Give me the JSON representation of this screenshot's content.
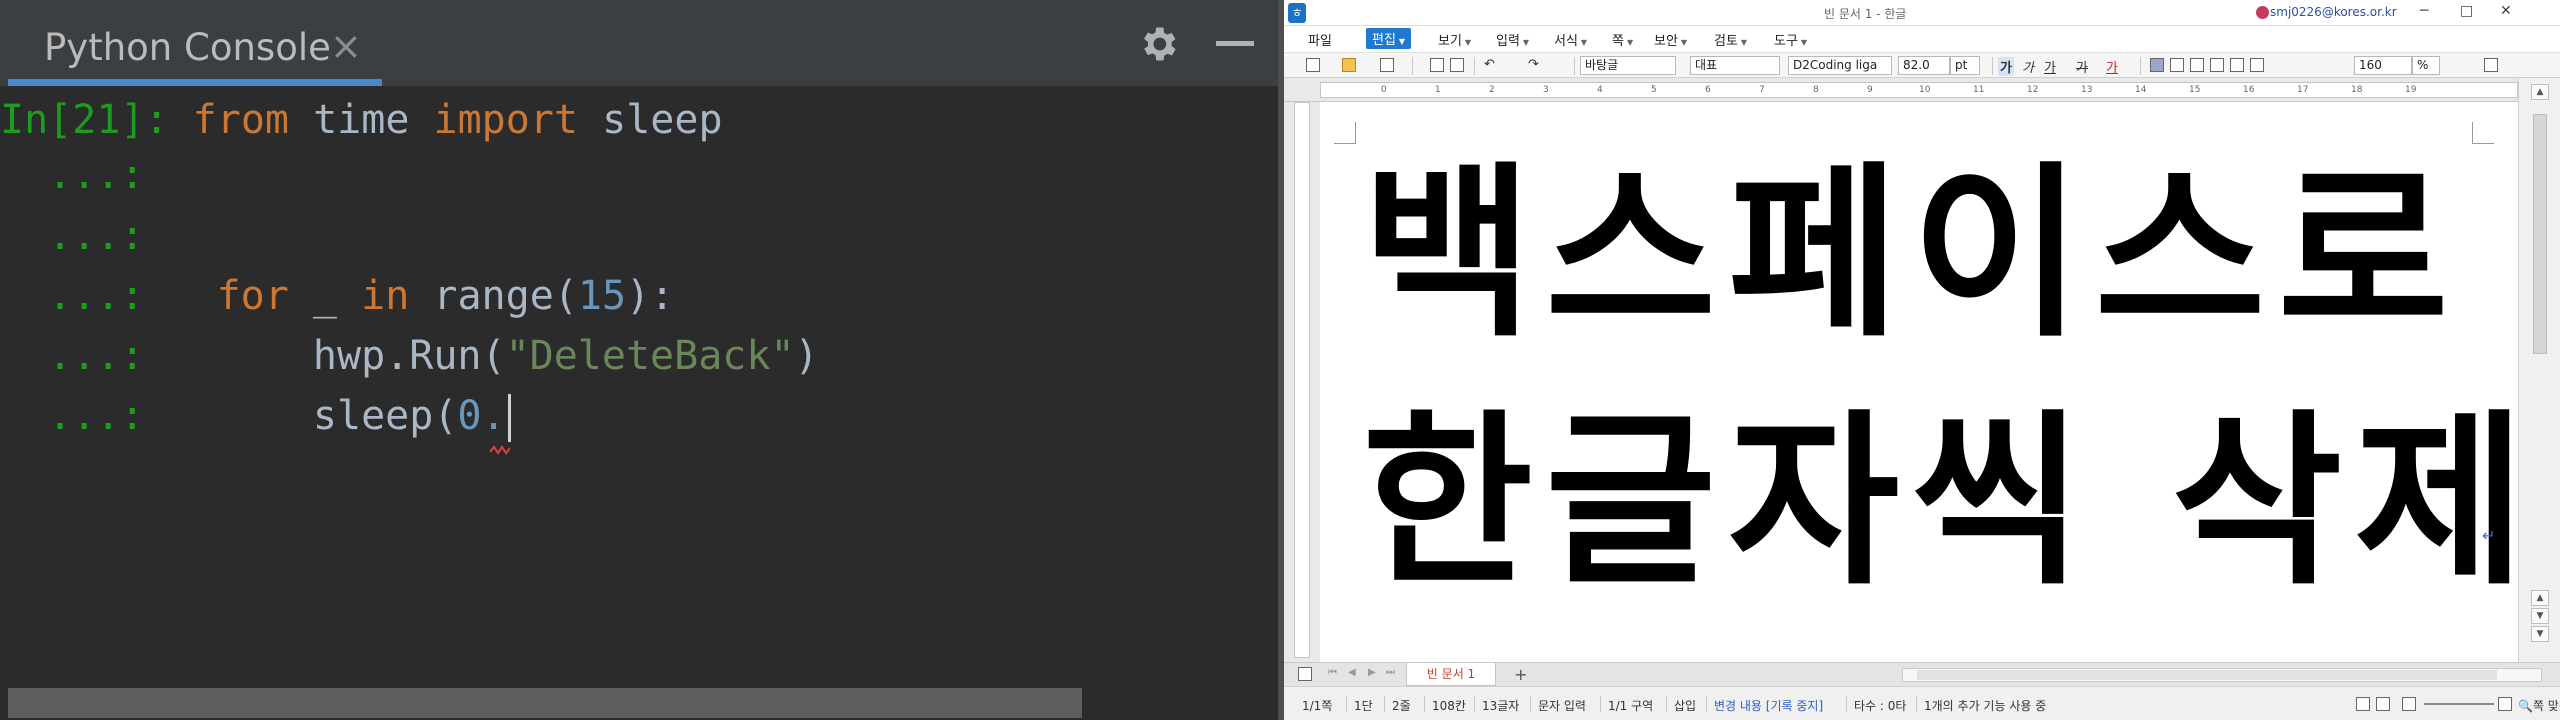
{
  "console": {
    "tab_title": "Python Console",
    "tab_close": "×",
    "prompt_main": "In[21]:",
    "prompt_cont": "...:",
    "lines": [
      {
        "kw1": "from",
        "mod": "time",
        "kw2": "import",
        "name": "sleep"
      },
      {},
      {},
      {
        "kw1": "for",
        "var": "_",
        "kw2": "in",
        "fn": "range(",
        "num": "15",
        "end": "):"
      },
      {
        "call": "hwp.Run(",
        "str": "\"DeleteBack\"",
        "end": ")"
      },
      {
        "call": "sleep(",
        "num": "0."
      }
    ]
  },
  "hwp": {
    "logo": "ㅎ",
    "doc_title": "빈 문서 1 - 한글",
    "user": "smj0226@kores.or.kr",
    "menu": {
      "file": "파일",
      "edit": "편집",
      "view": "보기",
      "insert": "입력",
      "format": "서식",
      "page": "쪽",
      "security": "보안",
      "review": "검토",
      "tools": "도구"
    },
    "toolbar": {
      "style": "바탕글",
      "lang": "대표",
      "font": "D2Coding liga",
      "size": "82.0",
      "unit": "pt",
      "ga_bold": "가",
      "ga_italic": "가",
      "ga_under": "가",
      "ga_strike": "가",
      "ga_color": "가",
      "line_spacing": "160",
      "percent": "%"
    },
    "document": {
      "line1": "백스페이스로",
      "line2": "한글자씩 삭제",
      "para_mark": "↵"
    },
    "doc_tab": "빈 문서 1",
    "tab_add": "+",
    "status": {
      "page": "1/1쪽",
      "section": "1단",
      "line": "2줄",
      "col": "108칸",
      "chars": "13글자",
      "mode": "문자 입력",
      "area": "1/1 구역",
      "insert": "삽입",
      "track": "변경 내용 [기록 중지]",
      "typo": "타수 : 0타",
      "addon": "1개의 추가 기능 사용 중",
      "zoom_fit": "쪽 맞춤"
    }
  }
}
